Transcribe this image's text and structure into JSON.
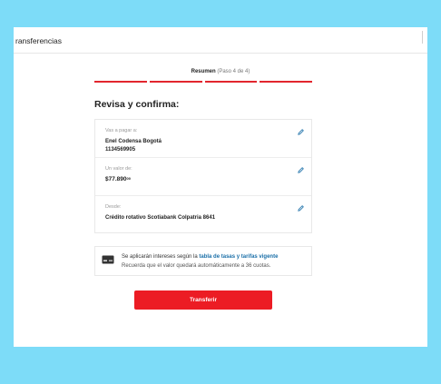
{
  "header": {
    "title": "ransferencias"
  },
  "steps": {
    "current": "Resumen",
    "count": "(Paso 4 de 4)",
    "total": 4,
    "completed": 4
  },
  "page": {
    "heading": "Revisa y confirma:"
  },
  "summary": {
    "recipient": {
      "label": "Vas a pagar a:",
      "name": "Enel Codensa Bogotá",
      "number": "1134569905"
    },
    "amount": {
      "label": "Un valor de:",
      "value": "$77.890",
      "cents": "00"
    },
    "source": {
      "label": "Desde:",
      "account": "Crédito rotativo Scotiabank Colpatria 8641"
    }
  },
  "info": {
    "text1": "Se aplicarán intereses según la",
    "link": "tabla de tasas y tarifas vigente",
    "text2": "Recuerda que el valor quedará automáticamente a 36 cuotas."
  },
  "actions": {
    "submit_label": "Transferir"
  },
  "colors": {
    "accent": "#ec1c24",
    "link": "#1a6fa8",
    "background": "#7ddcf8"
  },
  "icons": {
    "edit": "pencil-icon",
    "card": "credit-card-icon"
  }
}
